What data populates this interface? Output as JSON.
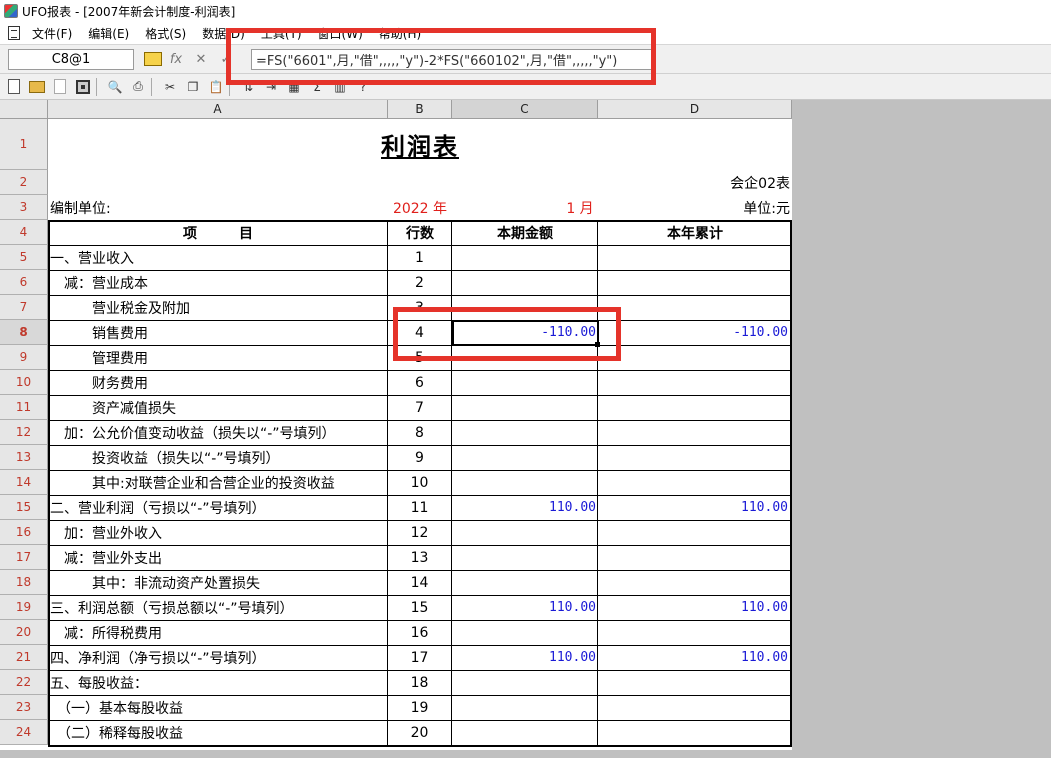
{
  "window": {
    "title": "UFO报表 - [2007年新会计制度-利润表]"
  },
  "menu": [
    "文件(F)",
    "编辑(E)",
    "格式(S)",
    "数据(D)",
    "工具(T)",
    "窗口(W)",
    "帮助(H)"
  ],
  "formula_bar": {
    "cell_ref": "C8@1",
    "fx_label": "fx",
    "cancel_glyph": "✕",
    "confirm_glyph": "✓",
    "formula": "=FS(\"6601\",月,\"借\",,,,,\"y\")-2*FS(\"660102\",月,\"借\",,,,,\"y\")"
  },
  "columns": [
    "A",
    "B",
    "C",
    "D"
  ],
  "active_column": "C",
  "active_row": 8,
  "report": {
    "title": "利润表",
    "form_code": "会企02表",
    "unit_label": "编制单位:",
    "year": "2022 年",
    "month": "1 月",
    "currency_unit": "单位:元",
    "headers": {
      "item": "项　　　目",
      "line": "行数",
      "current": "本期金额",
      "ytd": "本年累计"
    },
    "rows": [
      {
        "item": "一、营业收入",
        "line": "1",
        "current": "",
        "ytd": ""
      },
      {
        "item": "　减：营业成本",
        "line": "2",
        "current": "",
        "ytd": ""
      },
      {
        "item": "　　　营业税金及附加",
        "line": "3",
        "current": "",
        "ytd": ""
      },
      {
        "item": "　　　销售费用",
        "line": "4",
        "current": "-110.00",
        "ytd": "-110.00"
      },
      {
        "item": "　　　管理费用",
        "line": "5",
        "current": "",
        "ytd": ""
      },
      {
        "item": "　　　财务费用",
        "line": "6",
        "current": "",
        "ytd": ""
      },
      {
        "item": "　　　资产减值损失",
        "line": "7",
        "current": "",
        "ytd": ""
      },
      {
        "item": "　加：公允价值变动收益（损失以“-”号填列）",
        "line": "8",
        "current": "",
        "ytd": ""
      },
      {
        "item": "　　　投资收益（损失以“-”号填列）",
        "line": "9",
        "current": "",
        "ytd": ""
      },
      {
        "item": "　　　其中:对联营企业和合营企业的投资收益",
        "line": "10",
        "current": "",
        "ytd": ""
      },
      {
        "item": "二、营业利润（亏损以“-”号填列）",
        "line": "11",
        "current": "110.00",
        "ytd": "110.00"
      },
      {
        "item": "　加：营业外收入",
        "line": "12",
        "current": "",
        "ytd": ""
      },
      {
        "item": "　减：营业外支出",
        "line": "13",
        "current": "",
        "ytd": ""
      },
      {
        "item": "　　　其中：非流动资产处置损失",
        "line": "14",
        "current": "",
        "ytd": ""
      },
      {
        "item": "三、利润总额（亏损总额以“-”号填列）",
        "line": "15",
        "current": "110.00",
        "ytd": "110.00"
      },
      {
        "item": "　减：所得税费用",
        "line": "16",
        "current": "",
        "ytd": ""
      },
      {
        "item": "四、净利润（净亏损以“-”号填列）",
        "line": "17",
        "current": "110.00",
        "ytd": "110.00"
      },
      {
        "item": "五、每股收益：",
        "line": "18",
        "current": "",
        "ytd": ""
      },
      {
        "item": "　（一）基本每股收益",
        "line": "19",
        "current": "",
        "ytd": ""
      },
      {
        "item": "　（二）稀释每股收益",
        "line": "20",
        "current": "",
        "ytd": ""
      }
    ]
  },
  "colors": {
    "highlight": "#e5332a",
    "value_blue": "#1a1ad6",
    "date_red": "#e0201b"
  }
}
